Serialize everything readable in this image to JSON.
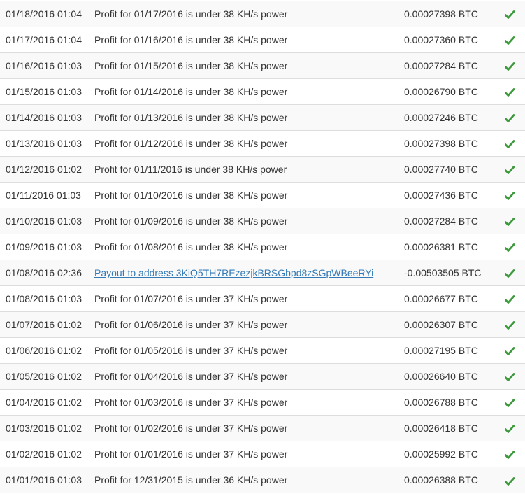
{
  "colors": {
    "check": "#3c9a3c",
    "link": "#337ab7",
    "text": "#333333",
    "border": "#dddddd",
    "stripe": "#f9f9f9"
  },
  "status_icon": "check-icon",
  "transactions": [
    {
      "date": "01/18/2016 01:04",
      "description": "Profit for 01/17/2016 is under 38 KH/s power",
      "amount": "0.00027398 BTC",
      "type": "profit"
    },
    {
      "date": "01/17/2016 01:04",
      "description": "Profit for 01/16/2016 is under 38 KH/s power",
      "amount": "0.00027360 BTC",
      "type": "profit"
    },
    {
      "date": "01/16/2016 01:03",
      "description": "Profit for 01/15/2016 is under 38 KH/s power",
      "amount": "0.00027284 BTC",
      "type": "profit"
    },
    {
      "date": "01/15/2016 01:03",
      "description": "Profit for 01/14/2016 is under 38 KH/s power",
      "amount": "0.00026790 BTC",
      "type": "profit"
    },
    {
      "date": "01/14/2016 01:03",
      "description": "Profit for 01/13/2016 is under 38 KH/s power",
      "amount": "0.00027246 BTC",
      "type": "profit"
    },
    {
      "date": "01/13/2016 01:03",
      "description": "Profit for 01/12/2016 is under 38 KH/s power",
      "amount": "0.00027398 BTC",
      "type": "profit"
    },
    {
      "date": "01/12/2016 01:02",
      "description": "Profit for 01/11/2016 is under 38 KH/s power",
      "amount": "0.00027740 BTC",
      "type": "profit"
    },
    {
      "date": "01/11/2016 01:03",
      "description": "Profit for 01/10/2016 is under 38 KH/s power",
      "amount": "0.00027436 BTC",
      "type": "profit"
    },
    {
      "date": "01/10/2016 01:03",
      "description": "Profit for 01/09/2016 is under 38 KH/s power",
      "amount": "0.00027284 BTC",
      "type": "profit"
    },
    {
      "date": "01/09/2016 01:03",
      "description": "Profit for 01/08/2016 is under 38 KH/s power",
      "amount": "0.00026381 BTC",
      "type": "profit"
    },
    {
      "date": "01/08/2016 02:36",
      "description": "Payout to address 3KiQ5TH7REzezjkBRSGbpd8zSGpWBeeRYi",
      "amount": "-0.00503505 BTC",
      "type": "payout"
    },
    {
      "date": "01/08/2016 01:03",
      "description": "Profit for 01/07/2016 is under 37 KH/s power",
      "amount": "0.00026677 BTC",
      "type": "profit"
    },
    {
      "date": "01/07/2016 01:02",
      "description": "Profit for 01/06/2016 is under 37 KH/s power",
      "amount": "0.00026307 BTC",
      "type": "profit"
    },
    {
      "date": "01/06/2016 01:02",
      "description": "Profit for 01/05/2016 is under 37 KH/s power",
      "amount": "0.00027195 BTC",
      "type": "profit"
    },
    {
      "date": "01/05/2016 01:02",
      "description": "Profit for 01/04/2016 is under 37 KH/s power",
      "amount": "0.00026640 BTC",
      "type": "profit"
    },
    {
      "date": "01/04/2016 01:02",
      "description": "Profit for 01/03/2016 is under 37 KH/s power",
      "amount": "0.00026788 BTC",
      "type": "profit"
    },
    {
      "date": "01/03/2016 01:02",
      "description": "Profit for 01/02/2016 is under 37 KH/s power",
      "amount": "0.00026418 BTC",
      "type": "profit"
    },
    {
      "date": "01/02/2016 01:02",
      "description": "Profit for 01/01/2016 is under 37 KH/s power",
      "amount": "0.00025992 BTC",
      "type": "profit"
    },
    {
      "date": "01/01/2016 01:03",
      "description": "Profit for 12/31/2015 is under 36 KH/s power",
      "amount": "0.00026388 BTC",
      "type": "profit"
    }
  ]
}
